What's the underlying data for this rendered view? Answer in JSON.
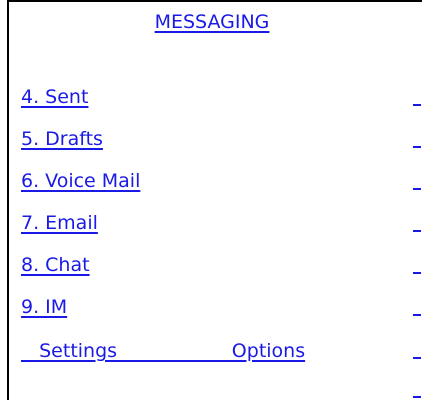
{
  "screen": {
    "title": "MESSAGING"
  },
  "menu": {
    "items": [
      {
        "label": "4. Sent"
      },
      {
        "label": "5. Drafts"
      },
      {
        "label": "6. Voice Mail"
      },
      {
        "label": "7. Email"
      },
      {
        "label": "8. Chat"
      },
      {
        "label": "9. IM"
      }
    ]
  },
  "softkeys": {
    "label": "   Settings                   Options",
    "left": "Settings",
    "right": "Options"
  },
  "colors": {
    "link": "#1a1ae6",
    "border": "#000000",
    "background": "#ffffff"
  }
}
